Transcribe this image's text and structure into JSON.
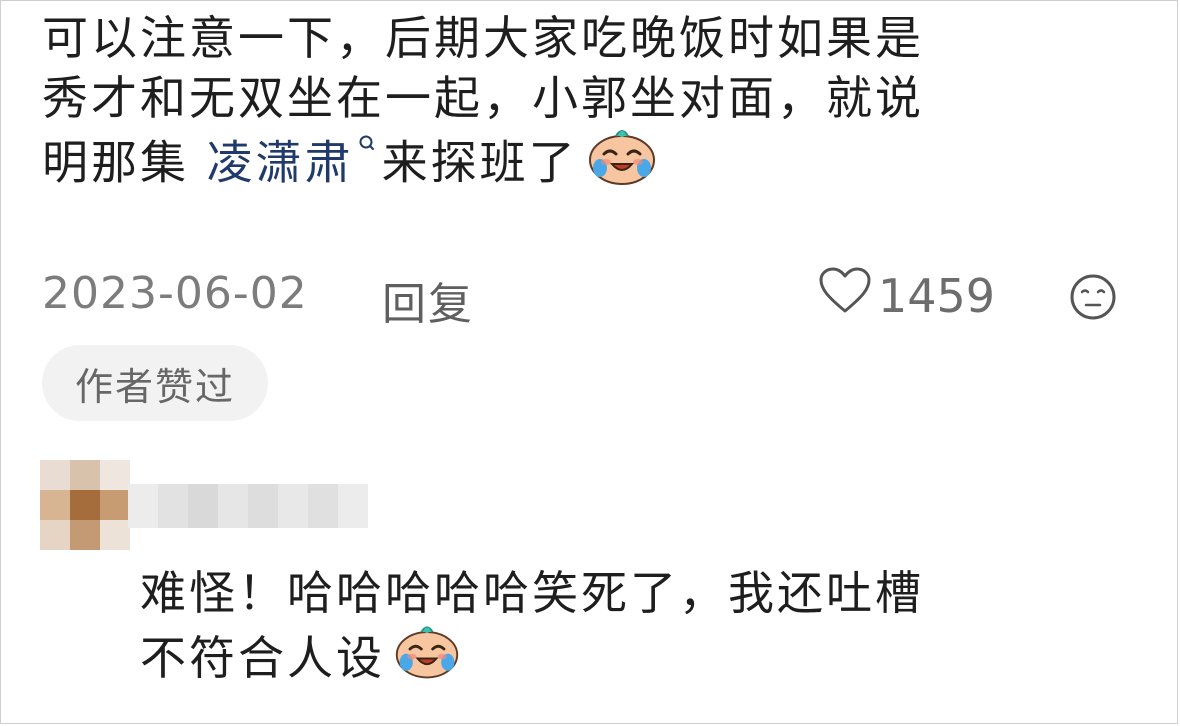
{
  "comment": {
    "line1": "可以注意一下，后期大家吃晚饭时如果是",
    "line2": "秀才和无双坐在一起，小郭坐对面，就说",
    "line3_prefix": "明那集 ",
    "mention": "凌潇肃",
    "line3_suffix": "来探班了",
    "emoji": "crying-laughing-face",
    "date": "2023-06-02",
    "reply_label": "回复",
    "like_count": "1459",
    "badge": "作者赞过"
  },
  "reply": {
    "line1": "难怪！哈哈哈哈哈笑死了，我还吐槽",
    "line2": "不符合人设",
    "emoji": "crying-laughing-face"
  },
  "icons": {
    "like": "heart-outline-icon",
    "dislike": "meh-face-icon",
    "search": "search-icon"
  },
  "colors": {
    "text": "#1e1e1e",
    "mention": "#1f3a6b",
    "meta": "#7c7c7c",
    "badge_bg": "#f2f2f2"
  }
}
